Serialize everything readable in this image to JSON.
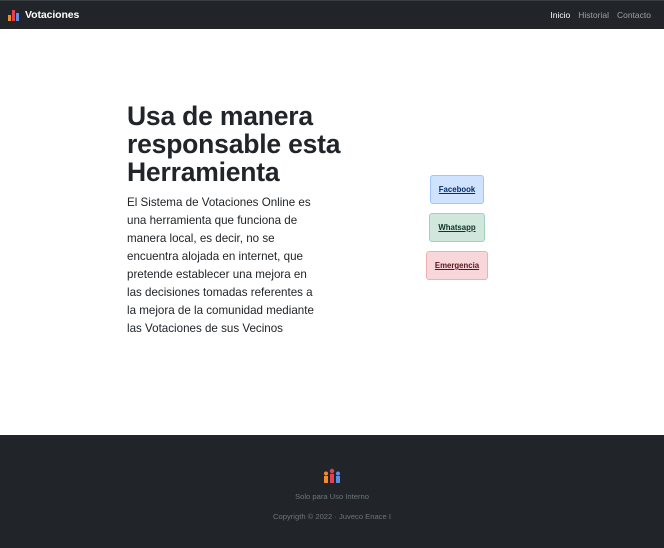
{
  "navbar": {
    "brand": "Votaciones",
    "links": [
      {
        "label": "Inicio",
        "active": true
      },
      {
        "label": "Historial",
        "active": false
      },
      {
        "label": "Contacto",
        "active": false
      }
    ]
  },
  "hero": {
    "title": "Usa de manera responsable esta Herramienta",
    "description": "El Sistema de Votaciones Online es una herramienta que funciona de manera local, es decir, no se encuentra alojada en internet, que pretende establecer una mejora en las decisiones tomadas referentes a la mejora de la comunidad mediante las Votaciones de sus Vecinos"
  },
  "buttons": {
    "facebook": "Facebook",
    "whatsapp": "Whatsapp",
    "emergencia": "Emergencia"
  },
  "footer": {
    "note": "Solo para Uso Interno",
    "copyright": "Copyrigth © 2022 · Juveco Enace I"
  },
  "colors": {
    "navbar_bg": "#212529",
    "facebook_bg": "#cfe2ff",
    "whatsapp_bg": "#d1e7dd",
    "emergencia_bg": "#f8d7da",
    "logo_orange": "#f28b30",
    "logo_red": "#e0434f",
    "logo_blue": "#5b8ee6"
  },
  "icons": {
    "brand": "bar-chart-icon",
    "footer": "people-icon"
  }
}
